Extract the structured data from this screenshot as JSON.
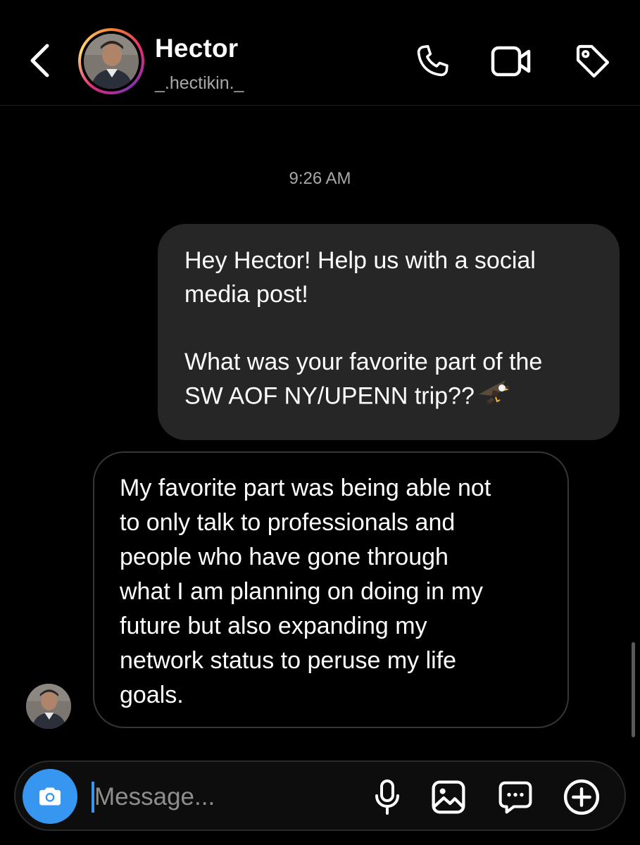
{
  "header": {
    "name": "Hector",
    "handle": "_.hectikin._",
    "icons": {
      "back": "chevron-left-icon",
      "call": "phone-icon",
      "video": "video-camera-icon",
      "tag": "tag-icon"
    }
  },
  "chat": {
    "timestamp": "9:26 AM",
    "outgoing": {
      "lines": [
        "Hey Hector! Help us with a social",
        "media post!",
        "",
        "What was your favorite part of the",
        "SW AOF NY/UPENN trip??"
      ],
      "emoji": "eagle"
    },
    "incoming": {
      "lines": [
        "My favorite part was being able not",
        "to only talk to professionals and",
        "people who have gone through",
        "what I am planning on doing in my",
        "future but also expanding my",
        "network status to peruse my life",
        "goals."
      ]
    }
  },
  "composer": {
    "placeholder": "Message...",
    "value": "",
    "icons": {
      "camera": "camera-icon",
      "mic": "microphone-icon",
      "gallery": "image-icon",
      "sticker": "sticker-message-icon",
      "more": "plus-circle-icon"
    }
  },
  "colors": {
    "background": "#000000",
    "outgoing_bubble": "#262626",
    "incoming_border": "#363636",
    "accent_blue": "#3797f0",
    "secondary_text": "#a8a8a8"
  }
}
